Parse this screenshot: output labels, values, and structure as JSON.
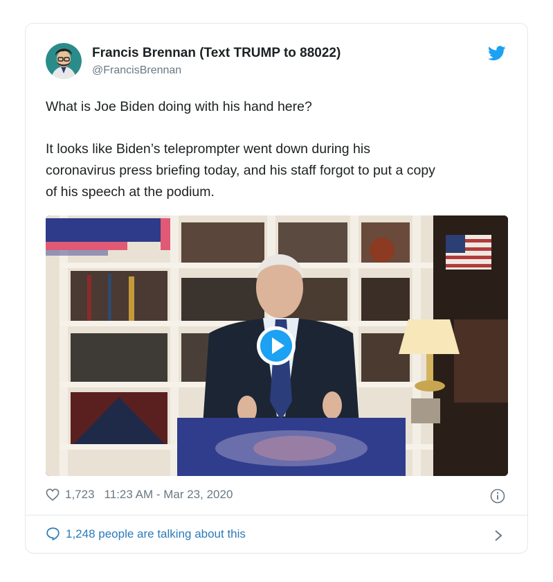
{
  "tweet": {
    "author": {
      "name": "Francis Brennan (Text TRUMP to 88022)",
      "handle": "@FrancisBrennan"
    },
    "text_line_1": "What is Joe Biden doing with his hand here?",
    "text_para2": [
      "It looks like Biden’s teleprompter went down during his",
      "coronavirus press briefing today, and his staff forgot to put a copy",
      "of his speech at the podium."
    ],
    "likes": "1,723",
    "timestamp": "11:23 AM - Mar 23, 2020",
    "talking": "1,248 people are talking about this"
  },
  "icons": {
    "brand": "twitter-bird-icon",
    "like": "heart-outline-icon",
    "info": "info-circle-icon",
    "reply": "speech-bubble-icon",
    "chevron": "chevron-right-icon",
    "media": "play-icon"
  },
  "colors": {
    "brand_blue": "#1da1f2",
    "link_blue": "#2b7bb9",
    "muted": "#697882",
    "border": "#e1e8ed"
  }
}
